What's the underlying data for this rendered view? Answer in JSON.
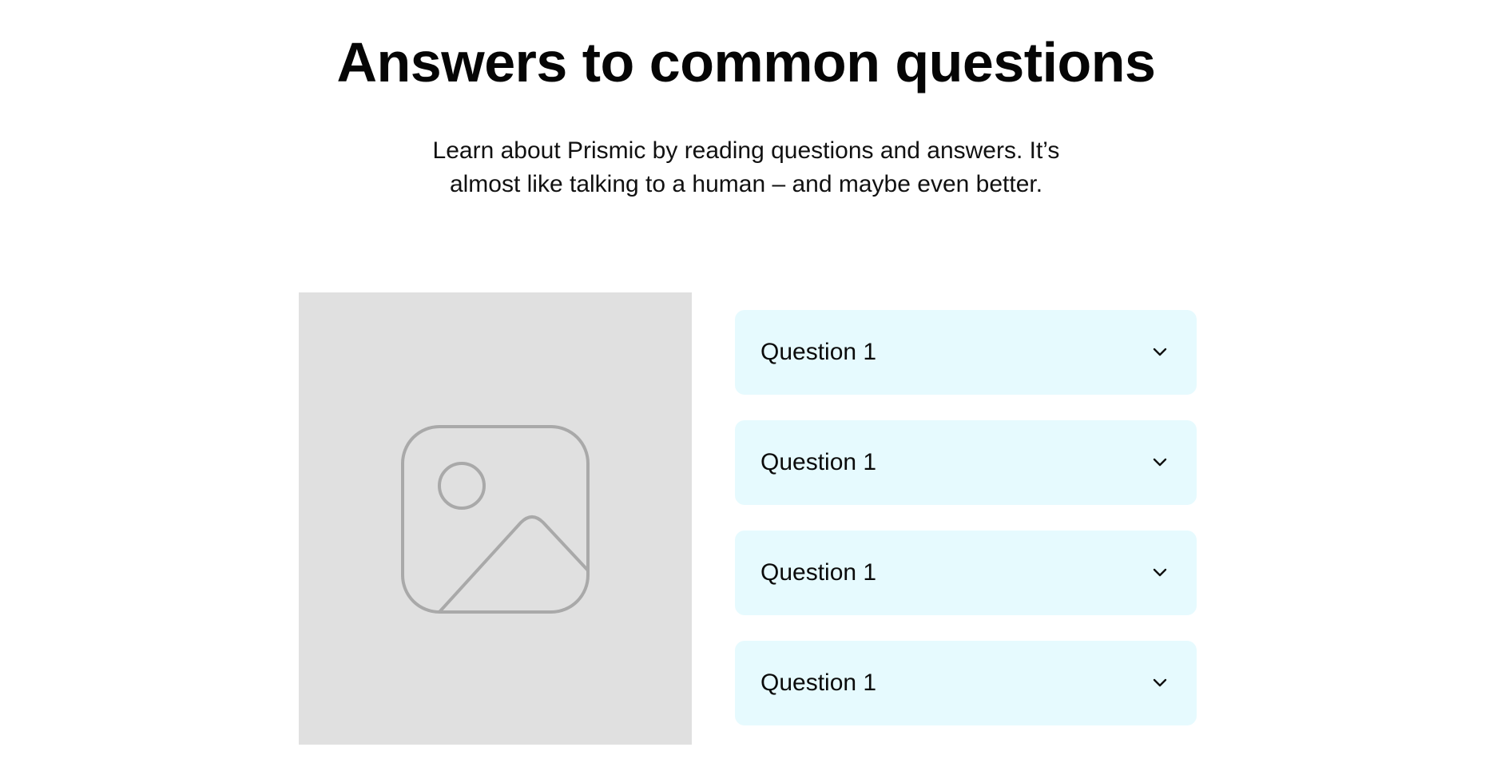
{
  "header": {
    "title": "Answers to common questions",
    "subtitle": "Learn about Prismic by reading questions and answers. It’s almost like talking to a human – and maybe even better."
  },
  "image": {
    "icon": "image-placeholder-icon",
    "background_color": "#e0e0e0",
    "icon_color": "#a9a9a9"
  },
  "faq": {
    "item_background": "#e6fafe",
    "items": [
      {
        "question": "Question 1",
        "icon": "chevron-down-icon"
      },
      {
        "question": "Question 1",
        "icon": "chevron-down-icon"
      },
      {
        "question": "Question 1",
        "icon": "chevron-down-icon"
      },
      {
        "question": "Question 1",
        "icon": "chevron-down-icon"
      }
    ]
  }
}
